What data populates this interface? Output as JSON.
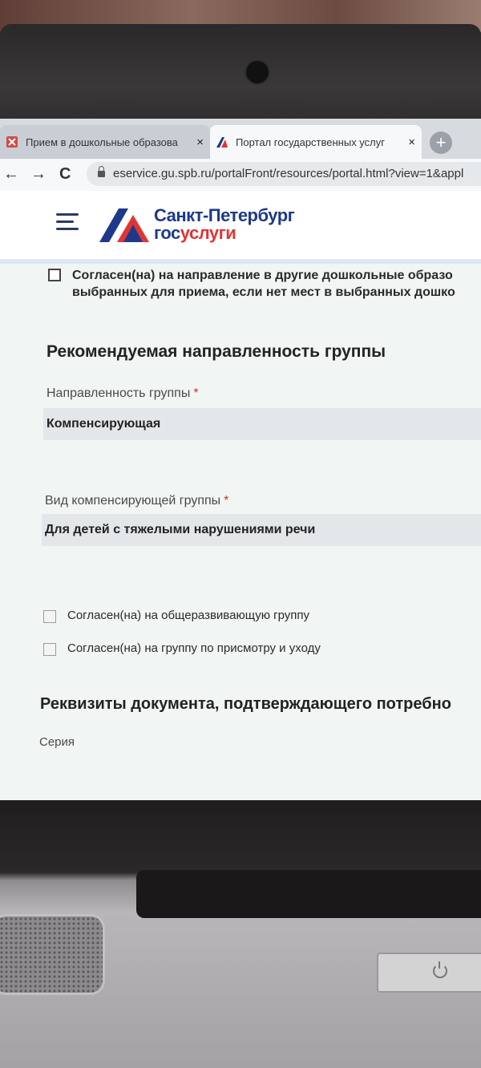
{
  "browser": {
    "tabs": [
      {
        "title": "Прием в дошкольные образова",
        "close": "×",
        "active": false
      },
      {
        "title": "Портал государственных услуг",
        "close": "×",
        "active": true
      }
    ],
    "new_tab": "+",
    "nav": {
      "back": "←",
      "forward": "→",
      "reload": "C"
    },
    "url": "eservice.gu.spb.ru/portalFront/resources/portal.html?view=1&appl"
  },
  "site": {
    "logo_city": "Санкт-Петербург",
    "logo_gos_prefix": "гос",
    "logo_gos_suffix": "услуги"
  },
  "form": {
    "agree_other": {
      "line1": "Согласен(на) на направление в другие дошкольные образо",
      "line2": "выбранных для приема, если нет мест в выбранных дошко",
      "checked": false
    },
    "section_group": "Рекомендуемая направленность группы",
    "group_focus_label": "Направленность группы",
    "group_focus_value": "Компенсирующая",
    "comp_type_label": "Вид компенсирующей группы",
    "comp_type_value": "Для детей с тяжелыми нарушениями речи",
    "required_mark": "*",
    "agree_general": {
      "label": "Согласен(на) на общеразвивающую группу",
      "checked": false
    },
    "agree_care": {
      "label": "Согласен(на) на группу по присмотру и уходу",
      "checked": false
    },
    "section_docs": "Реквизиты документа, подтверждающего потребно",
    "series_label": "Серия"
  },
  "taskbar": {
    "icons": [
      "start-orb-icon",
      "internet-explorer-icon",
      "chrome-icon",
      "media-player-icon",
      "clock-gadget-icon",
      "file-explorer-icon",
      "network-icon"
    ]
  },
  "colors": {
    "brand_blue": "#1d3a8a",
    "brand_red": "#e23434",
    "required_red": "#d03030"
  }
}
